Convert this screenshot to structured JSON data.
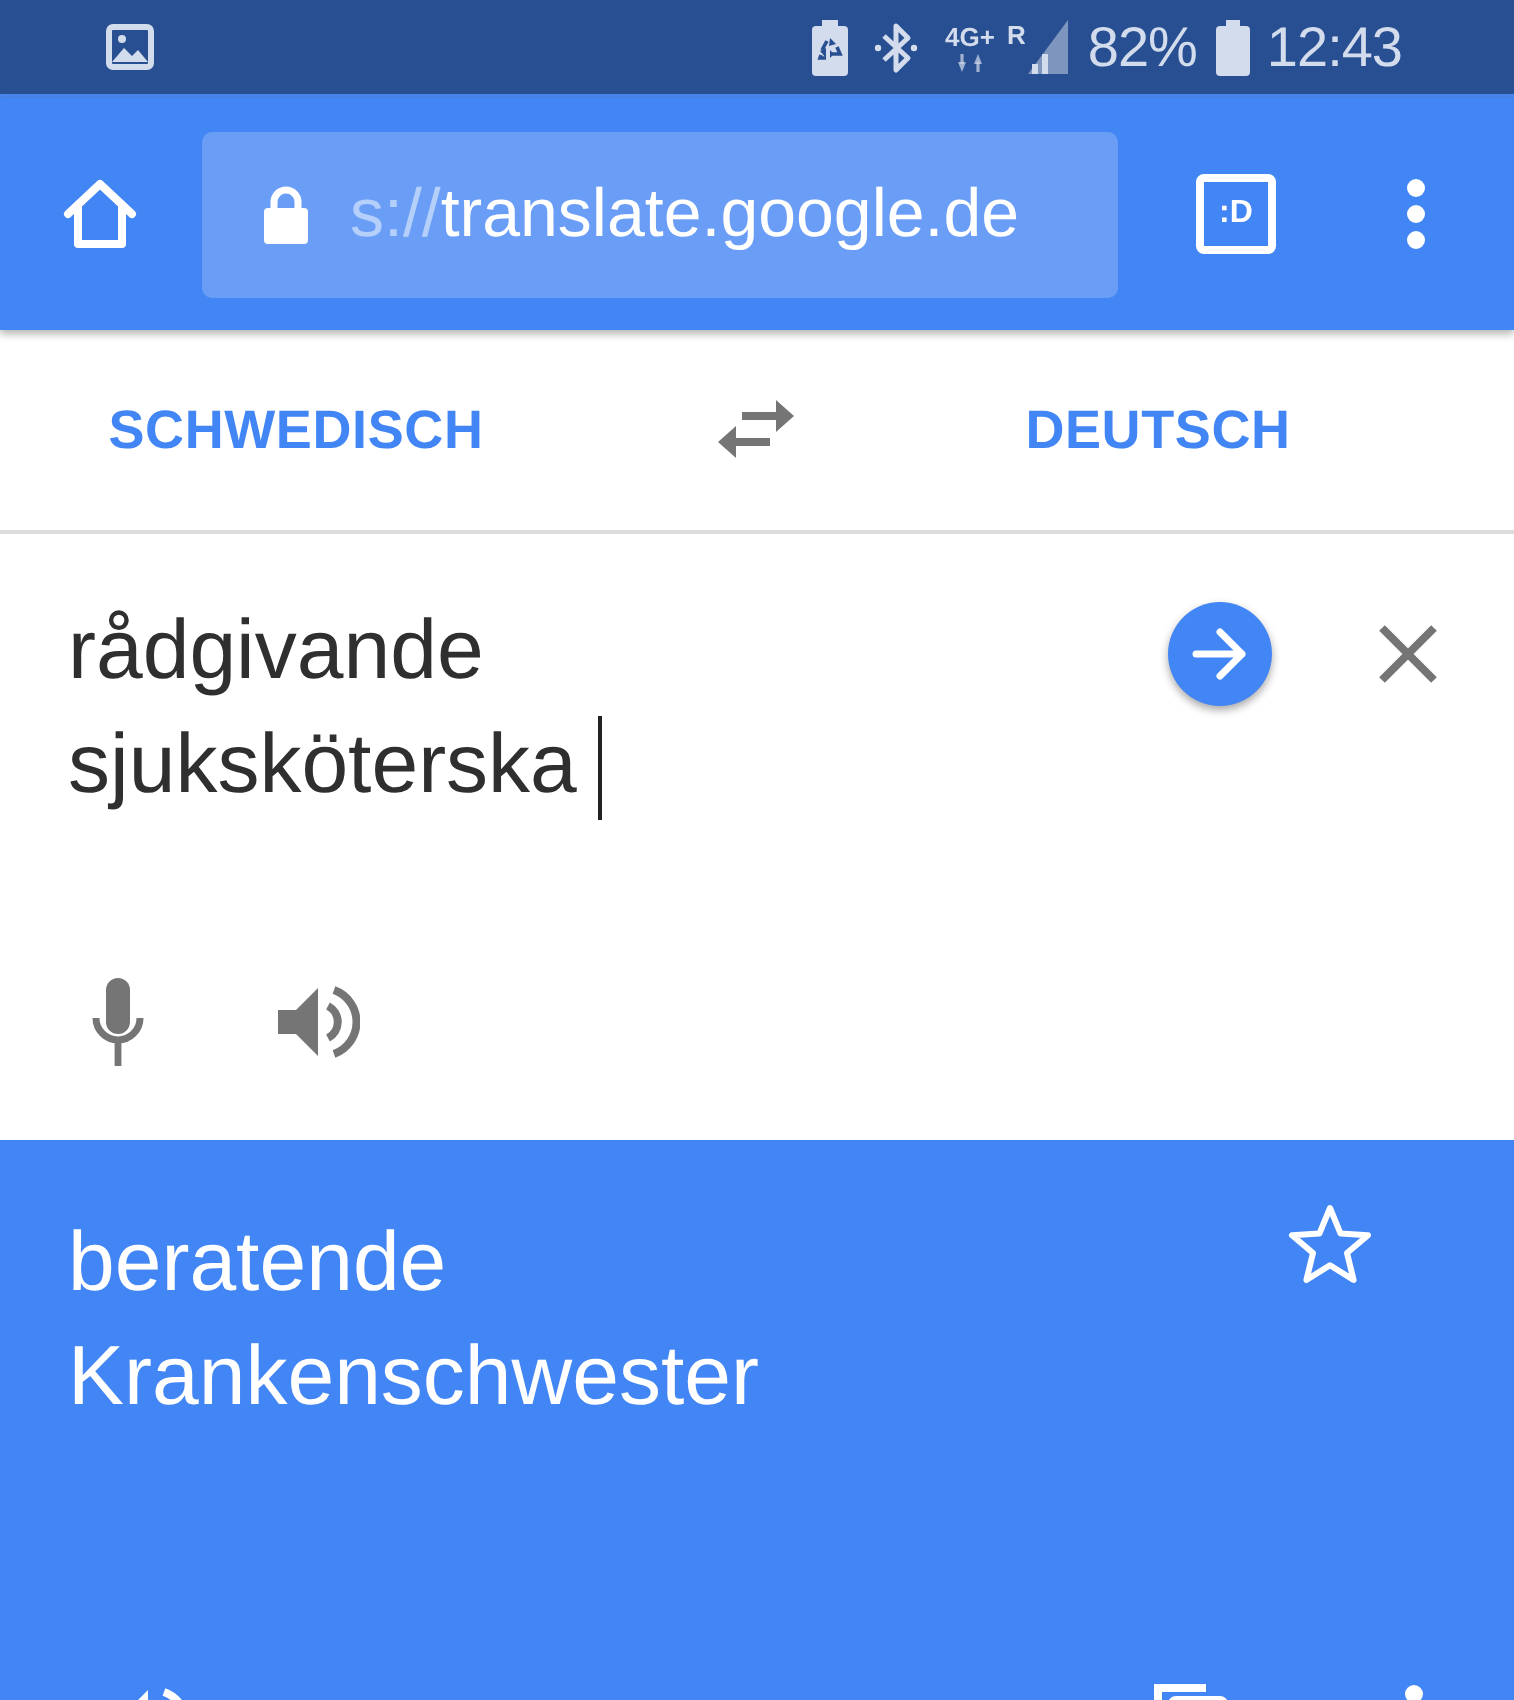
{
  "status_bar": {
    "network": "4G+",
    "roaming": "R",
    "battery": "82%",
    "time": "12:43"
  },
  "toolbar": {
    "url": {
      "scheme": "s://",
      "host": "translate.google.de"
    },
    "tab_switcher": ":D"
  },
  "languages": {
    "source": "SCHWEDISCH",
    "target": "DEUTSCH"
  },
  "input": {
    "value": "rådgivande sjuksköterska"
  },
  "output": {
    "text": "beratende Krankenschwester",
    "starred": false
  }
}
